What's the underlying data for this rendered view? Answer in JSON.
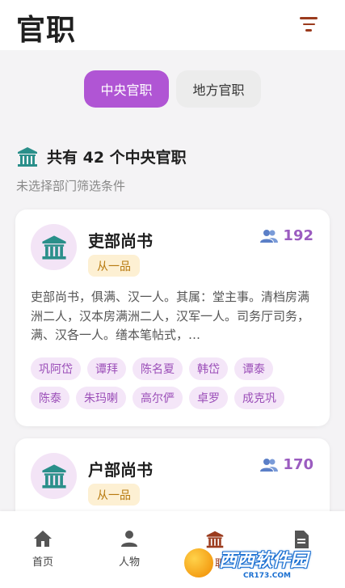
{
  "header": {
    "title": "官职",
    "filter_icon": "filter-icon"
  },
  "tabs": [
    {
      "label": "中央官职",
      "active": true
    },
    {
      "label": "地方官职",
      "active": false
    }
  ],
  "summary": {
    "icon": "court-building-icon",
    "title": "共有 42 个中央官职",
    "subtitle": "未选择部门筛选条件"
  },
  "cards": [
    {
      "icon": "court-building-icon",
      "title": "吏部尚书",
      "rank": "从一品",
      "count": "192",
      "count_icon": "people-icon",
      "description": "吏部尚书，俱满、汉一人。其属：堂主事。清档房满洲二人，汉本房满洲二人，汉军一人。司务厅司务，满、汉各一人。缮本笔帖式，…",
      "tags": [
        "巩阿岱",
        "谭拜",
        "陈名夏",
        "韩岱",
        "谭泰",
        "陈泰",
        "朱玛喇",
        "高尔俨",
        "卓罗",
        "成克巩"
      ]
    },
    {
      "icon": "court-building-icon",
      "title": "户部尚书",
      "rank": "从一品",
      "count": "170",
      "count_icon": "people-icon"
    }
  ],
  "nav": {
    "items": [
      {
        "label": "首页",
        "icon": "home-icon"
      },
      {
        "label": "人物",
        "icon": "person-icon"
      },
      {
        "label": "官职",
        "icon": "court-building-icon",
        "active": true
      },
      {
        "label": "",
        "icon": "document-icon"
      }
    ]
  },
  "watermark": {
    "big": "西西软件园",
    "small": "CR173.COM"
  },
  "colors": {
    "accent": "#b055d4",
    "rank_bg": "#fdf0d3",
    "rank_text": "#b7790e",
    "tag_bg": "#f4e6f8",
    "tag_text": "#9b4fb8",
    "nav_active": "#9b3b1d"
  }
}
